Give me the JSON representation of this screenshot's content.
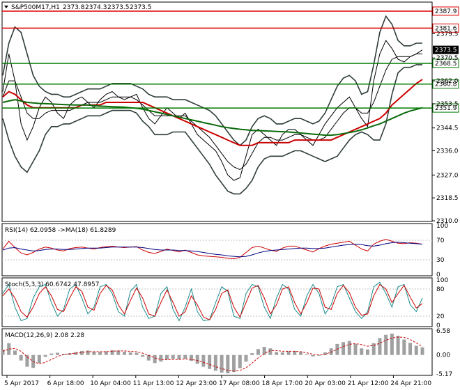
{
  "chart_data": {
    "type": "line",
    "title": "S&P500M17,H1",
    "ohlc": {
      "open": 2373.8,
      "high": 2374.3,
      "low": 2373.5,
      "close": 2373.5
    },
    "price": {
      "ylim": [
        2310.0,
        2391.0
      ],
      "yticks": [
        2310.0,
        2318.5,
        2327.0,
        2336.0,
        2344.5,
        2353.5,
        2362.0,
        2370.5,
        2379.5
      ],
      "levels": [
        {
          "label": "2387.9",
          "value": 2387.9,
          "color": "#e00000"
        },
        {
          "label": "2381.6",
          "value": 2381.6,
          "color": "#e00000"
        },
        {
          "label": "2368.5",
          "value": 2368.5,
          "color": "#007a00"
        },
        {
          "label": "2360.8",
          "value": 2360.8,
          "color": "#007a00"
        },
        {
          "label": "2351.9",
          "value": 2351.9,
          "color": "#007a00"
        }
      ],
      "current": {
        "label": "2373.5",
        "value": 2373.5
      },
      "series": [
        {
          "key": "price",
          "color": "#000000",
          "values": [
            2358,
            2372,
            2362,
            2346,
            2340,
            2345,
            2352,
            2356,
            2354,
            2350,
            2348,
            2353,
            2355,
            2356,
            2354,
            2352,
            2355,
            2357,
            2358,
            2356,
            2355,
            2356,
            2357,
            2352,
            2348,
            2346,
            2349,
            2352,
            2350,
            2348,
            2350,
            2346,
            2342,
            2340,
            2338,
            2336,
            2332,
            2327,
            2325,
            2326,
            2334,
            2342,
            2344,
            2342,
            2340,
            2338,
            2342,
            2344,
            2344,
            2342,
            2340,
            2338,
            2342,
            2346,
            2349,
            2352,
            2354,
            2356,
            2352,
            2348,
            2345,
            2362,
            2372,
            2377,
            2374,
            2370,
            2369,
            2371,
            2372,
            2373.5
          ]
        },
        {
          "key": "bb-mid",
          "color": "#000000",
          "values": [
            2356,
            2362,
            2362,
            2356,
            2350,
            2348,
            2348,
            2350,
            2351,
            2351,
            2351,
            2351,
            2352,
            2353,
            2354,
            2354,
            2354,
            2355,
            2356,
            2356,
            2356,
            2356,
            2355,
            2353,
            2351,
            2349,
            2349,
            2349,
            2349,
            2349,
            2349,
            2347,
            2345,
            2343,
            2341,
            2338,
            2335,
            2332,
            2330,
            2329,
            2331,
            2335,
            2339,
            2341,
            2341,
            2340,
            2340,
            2341,
            2342,
            2342,
            2341,
            2340,
            2340,
            2341,
            2344,
            2347,
            2350,
            2352,
            2352,
            2350,
            2350,
            2354,
            2360,
            2366,
            2370,
            2371,
            2371,
            2371,
            2372,
            2372
          ]
        },
        {
          "key": "bb-upper",
          "color": "#2e3d3a",
          "values": [
            2364,
            2376,
            2382,
            2380,
            2372,
            2364,
            2360,
            2358,
            2357,
            2357,
            2356,
            2356,
            2357,
            2358,
            2359,
            2359,
            2359,
            2360,
            2361,
            2361,
            2361,
            2361,
            2360,
            2359,
            2357,
            2356,
            2356,
            2356,
            2355,
            2355,
            2355,
            2354,
            2353,
            2352,
            2351,
            2349,
            2346,
            2343,
            2340,
            2338,
            2340,
            2345,
            2348,
            2349,
            2348,
            2346,
            2346,
            2347,
            2348,
            2348,
            2347,
            2346,
            2347,
            2350,
            2355,
            2360,
            2363,
            2364,
            2362,
            2357,
            2358,
            2368,
            2380,
            2386,
            2383,
            2377,
            2375,
            2375,
            2376,
            2376
          ]
        },
        {
          "key": "bb-lower",
          "color": "#2e3d3a",
          "values": [
            2348,
            2340,
            2334,
            2330,
            2328,
            2332,
            2336,
            2342,
            2345,
            2345,
            2346,
            2346,
            2347,
            2348,
            2349,
            2349,
            2349,
            2350,
            2351,
            2351,
            2351,
            2351,
            2350,
            2347,
            2345,
            2342,
            2342,
            2342,
            2343,
            2343,
            2343,
            2340,
            2337,
            2334,
            2331,
            2327,
            2324,
            2321,
            2320,
            2320,
            2322,
            2325,
            2330,
            2333,
            2334,
            2334,
            2334,
            2335,
            2336,
            2336,
            2335,
            2334,
            2333,
            2332,
            2333,
            2334,
            2337,
            2340,
            2342,
            2343,
            2342,
            2340,
            2340,
            2346,
            2357,
            2365,
            2367,
            2367,
            2368,
            2368
          ]
        },
        {
          "key": "ma-red",
          "color": "#cc0000",
          "values": [
            2356,
            2358,
            2357,
            2355,
            2353,
            2352,
            2352,
            2352,
            2352,
            2352,
            2352,
            2352,
            2352,
            2353,
            2353,
            2353,
            2353,
            2354,
            2354,
            2354,
            2354,
            2354,
            2354,
            2354,
            2353,
            2352,
            2351,
            2350,
            2349,
            2348,
            2347,
            2346,
            2345,
            2344,
            2343,
            2342,
            2341,
            2340,
            2339,
            2338,
            2338,
            2338,
            2339,
            2339,
            2339,
            2339,
            2339,
            2339,
            2340,
            2340,
            2340,
            2340,
            2340,
            2340,
            2340,
            2341,
            2342,
            2343,
            2344,
            2345,
            2346,
            2347,
            2348,
            2350,
            2353,
            2355,
            2357,
            2359,
            2361,
            2362.5
          ]
        },
        {
          "key": "ma-green",
          "color": "#0a6a0a",
          "values": [
            2354,
            2354.5,
            2355,
            2354.5,
            2354,
            2353.8,
            2353.6,
            2353.5,
            2353.4,
            2353.3,
            2353.2,
            2353.1,
            2353,
            2353,
            2353,
            2352.8,
            2352.6,
            2352.5,
            2352.4,
            2352.3,
            2352.2,
            2352,
            2351.8,
            2351.5,
            2351,
            2350.5,
            2350,
            2349.5,
            2349,
            2348.5,
            2348,
            2347.5,
            2347,
            2346.5,
            2346,
            2345.5,
            2345,
            2344.6,
            2344.3,
            2344,
            2343.8,
            2343.6,
            2343.5,
            2343.4,
            2343.3,
            2343.2,
            2343.1,
            2343,
            2342.8,
            2342.6,
            2342.4,
            2342.2,
            2342,
            2341.8,
            2341.8,
            2342,
            2342.4,
            2342.8,
            2343.2,
            2343.8,
            2344.5,
            2345.3,
            2346,
            2347,
            2348,
            2349,
            2350,
            2350.8,
            2351.4,
            2352
          ]
        }
      ]
    },
    "rsi": {
      "label": "RSI(14) 62.0958 ->MA(18) 61.8289",
      "ylim": [
        0,
        100
      ],
      "yticks": [
        "100",
        "70",
        "30",
        "0"
      ],
      "series": [
        {
          "key": "rsi",
          "color": "#cc0000",
          "values": [
            52,
            68,
            55,
            44,
            40,
            45,
            52,
            56,
            54,
            50,
            48,
            53,
            55,
            56,
            54,
            52,
            55,
            57,
            58,
            56,
            55,
            56,
            57,
            50,
            45,
            43,
            47,
            52,
            49,
            46,
            50,
            45,
            40,
            38,
            37,
            36,
            35,
            33,
            32,
            35,
            45,
            55,
            58,
            54,
            50,
            47,
            54,
            58,
            58,
            54,
            50,
            46,
            53,
            58,
            62,
            64,
            66,
            68,
            60,
            52,
            48,
            62,
            68,
            72,
            68,
            64,
            63,
            65,
            64,
            62
          ]
        },
        {
          "key": "rsi-ma",
          "color": "#000080",
          "values": [
            50,
            54,
            55,
            52,
            50,
            48,
            49,
            51,
            52,
            52,
            51,
            51,
            52,
            53,
            54,
            54,
            54,
            55,
            56,
            56,
            56,
            56,
            56,
            55,
            53,
            51,
            50,
            50,
            50,
            49,
            49,
            48,
            47,
            45,
            43,
            41,
            40,
            38,
            37,
            36,
            37,
            40,
            44,
            47,
            49,
            50,
            51,
            52,
            53,
            54,
            54,
            53,
            53,
            54,
            56,
            58,
            60,
            61,
            62,
            61,
            59,
            58,
            60,
            63,
            65,
            66,
            65,
            64,
            63,
            62
          ]
        }
      ]
    },
    "stoch": {
      "label": "Stoch(5,3,3) 60.6742 47.8957",
      "ylim": [
        0,
        100
      ],
      "yticks": [
        "100",
        "80",
        "20",
        "0"
      ],
      "series": [
        {
          "key": "stoch-main",
          "color": "#1a8a8a",
          "values": [
            70,
            90,
            40,
            10,
            15,
            60,
            85,
            90,
            50,
            20,
            35,
            80,
            90,
            60,
            25,
            40,
            85,
            90,
            70,
            30,
            20,
            75,
            90,
            40,
            15,
            20,
            70,
            85,
            35,
            10,
            40,
            80,
            30,
            10,
            12,
            50,
            85,
            75,
            20,
            15,
            70,
            90,
            85,
            40,
            15,
            60,
            90,
            80,
            35,
            20,
            65,
            90,
            70,
            25,
            45,
            85,
            90,
            60,
            30,
            15,
            30,
            85,
            95,
            70,
            40,
            85,
            90,
            45,
            30,
            60
          ]
        },
        {
          "key": "stoch-signal",
          "color": "#cc0000",
          "values": [
            65,
            80,
            60,
            30,
            18,
            40,
            70,
            85,
            65,
            35,
            30,
            60,
            85,
            75,
            40,
            33,
            70,
            88,
            78,
            45,
            25,
            55,
            82,
            60,
            25,
            20,
            50,
            78,
            50,
            20,
            30,
            65,
            45,
            18,
            12,
            35,
            70,
            78,
            40,
            18,
            50,
            82,
            88,
            60,
            25,
            45,
            80,
            85,
            50,
            25,
            50,
            82,
            80,
            40,
            35,
            70,
            88,
            72,
            40,
            22,
            25,
            65,
            90,
            80,
            50,
            70,
            88,
            62,
            38,
            48
          ]
        }
      ]
    },
    "macd": {
      "label": "MACD(12,26,9) 2.08 2.28",
      "ylim": [
        -5.17,
        6.58
      ],
      "yticks": [
        "6.58",
        "0.00",
        "-5.17"
      ],
      "series": [
        {
          "key": "macd-hist",
          "color": "#a0a0a0",
          "values": [
            1.5,
            3.2,
            1.2,
            -1.5,
            -3.2,
            -3.5,
            -2.2,
            -0.5,
            0.4,
            0.6,
            0.3,
            0.5,
            0.8,
            1.1,
            1.2,
            0.9,
            0.8,
            1.0,
            1.3,
            1.2,
            0.9,
            0.7,
            0.6,
            -0.5,
            -1.5,
            -2.2,
            -1.8,
            -1.2,
            -1.0,
            -1.2,
            -1.0,
            -1.6,
            -2.4,
            -3.2,
            -3.8,
            -4.3,
            -4.8,
            -5.0,
            -4.6,
            -3.6,
            -1.8,
            0.5,
            1.6,
            2.2,
            1.8,
            0.8,
            0.7,
            1.0,
            1.1,
            0.8,
            0.2,
            -0.4,
            -0.2,
            0.7,
            1.8,
            3.0,
            3.5,
            3.8,
            3.0,
            1.8,
            1.5,
            3.2,
            4.6,
            5.5,
            5.8,
            5.2,
            4.2,
            3.3,
            2.5,
            2.08
          ]
        },
        {
          "key": "macd-signal",
          "color": "#cc0000",
          "values": [
            1.0,
            1.6,
            1.8,
            1.0,
            -0.5,
            -1.8,
            -2.4,
            -2.0,
            -1.2,
            -0.4,
            0.1,
            0.3,
            0.5,
            0.7,
            0.9,
            0.9,
            0.9,
            0.9,
            1.0,
            1.1,
            1.1,
            1.0,
            0.9,
            0.5,
            -0.1,
            -0.8,
            -1.2,
            -1.3,
            -1.2,
            -1.2,
            -1.1,
            -1.2,
            -1.5,
            -2.0,
            -2.6,
            -3.2,
            -3.7,
            -4.2,
            -4.4,
            -4.2,
            -3.5,
            -2.2,
            -0.8,
            0.4,
            1.2,
            1.2,
            1.0,
            1.0,
            1.0,
            0.9,
            0.6,
            0.2,
            0.0,
            0.2,
            0.8,
            1.6,
            2.3,
            2.9,
            3.1,
            2.8,
            2.4,
            2.6,
            3.2,
            4.0,
            4.6,
            4.9,
            4.8,
            4.2,
            3.3,
            2.28
          ]
        }
      ]
    },
    "x_labels": [
      "5 Apr 2017",
      "6 Apr 18:00",
      "10 Apr 04:00",
      "11 Apr 13:00",
      "12 Apr 23:00",
      "17 Apr 08:00",
      "18 Apr 17:00",
      "20 Apr 03:00",
      "21 Apr 12:00",
      "24 Apr 21:00"
    ]
  }
}
